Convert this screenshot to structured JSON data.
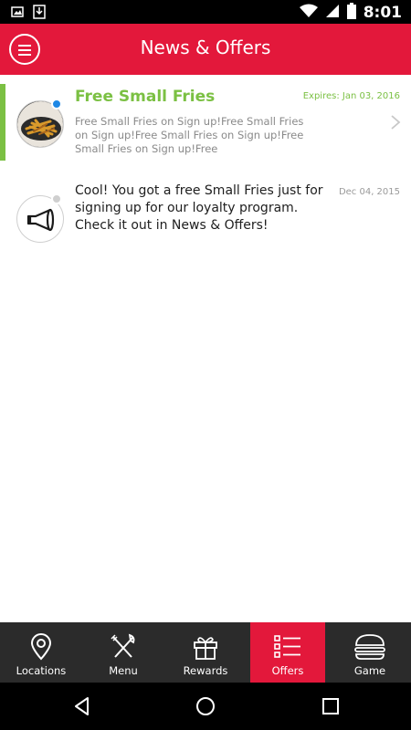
{
  "status_bar": {
    "time": "8:01",
    "left_icons": [
      "image-icon",
      "download-icon"
    ],
    "right_icons": [
      "wifi-icon",
      "signal-icon",
      "battery-icon"
    ]
  },
  "app_bar": {
    "title": "News & Offers",
    "menu_icon": "menu-icon"
  },
  "messages": [
    {
      "title": "Free Small Fries",
      "meta": "Expires: Jan 03, 2016",
      "body": "Free Small Fries on Sign up!Free Small Fries on Sign up!Free Small Fries on Sign up!Free Small Fries on Sign up!Free",
      "unread": true,
      "thumbnail": "fries-image"
    },
    {
      "meta": "Dec 04, 2015",
      "body": "Cool! You got a free Small Fries just for signing up for our loyalty program. Check it out in News & Offers!",
      "unread": false,
      "thumbnail": "horn-icon"
    }
  ],
  "bottom_nav": {
    "items": [
      {
        "label": "Locations",
        "icon": "location-pin-icon"
      },
      {
        "label": "Menu",
        "icon": "fork-knife-icon"
      },
      {
        "label": "Rewards",
        "icon": "gift-icon"
      },
      {
        "label": "Offers",
        "icon": "list-icon",
        "active": true
      },
      {
        "label": "Game",
        "icon": "burger-icon"
      }
    ]
  },
  "colors": {
    "brand_red": "#e3183b",
    "accent_green": "#7bc043",
    "unread_dot": "#1e88e5",
    "read_dot": "#cfcfcf",
    "nav_bg": "#2b2b2b"
  }
}
